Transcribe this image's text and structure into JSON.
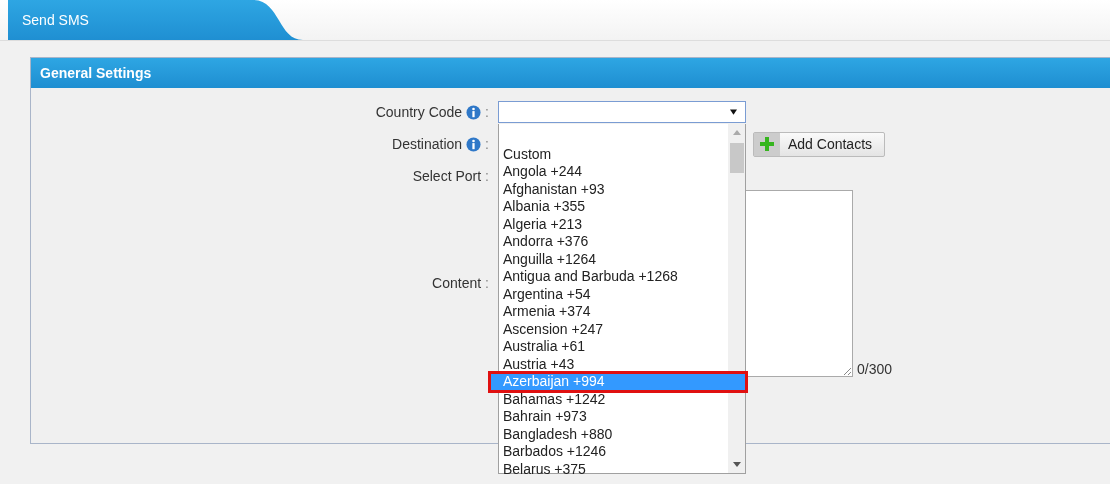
{
  "tab": {
    "label": "Send SMS"
  },
  "panel": {
    "title": "General Settings",
    "fields": [
      {
        "kind": "select",
        "label": "Country Code",
        "info": true,
        "suffix": ":"
      },
      {
        "kind": "destination",
        "label": "Destination",
        "info": true,
        "suffix": ":",
        "button": "Add Contacts"
      },
      {
        "kind": "port",
        "label": "Select Port",
        "info": false,
        "suffix": ":"
      },
      {
        "kind": "textarea",
        "label": "Content",
        "info": false,
        "suffix": ":",
        "counter": "0/300"
      }
    ]
  },
  "dropdown": {
    "options": [
      {
        "label": "Custom",
        "selected": false
      },
      {
        "label": "Angola +244",
        "selected": false
      },
      {
        "label": "Afghanistan +93",
        "selected": false
      },
      {
        "label": "Albania +355",
        "selected": false
      },
      {
        "label": "Algeria +213",
        "selected": false
      },
      {
        "label": "Andorra +376",
        "selected": false
      },
      {
        "label": "Anguilla +1264",
        "selected": false
      },
      {
        "label": "Antigua and Barbuda +1268",
        "selected": false
      },
      {
        "label": "Argentina +54",
        "selected": false
      },
      {
        "label": "Armenia +374",
        "selected": false
      },
      {
        "label": "Ascension +247",
        "selected": false
      },
      {
        "label": "Australia +61",
        "selected": false
      },
      {
        "label": "Austria +43",
        "selected": false
      },
      {
        "label": "Azerbaijan +994",
        "selected": true
      },
      {
        "label": "Bahamas +1242",
        "selected": false
      },
      {
        "label": "Bahrain +973",
        "selected": false
      },
      {
        "label": "Bangladesh +880",
        "selected": false
      },
      {
        "label": "Barbados +1246",
        "selected": false
      },
      {
        "label": "Belarus +375",
        "selected": false
      }
    ]
  }
}
